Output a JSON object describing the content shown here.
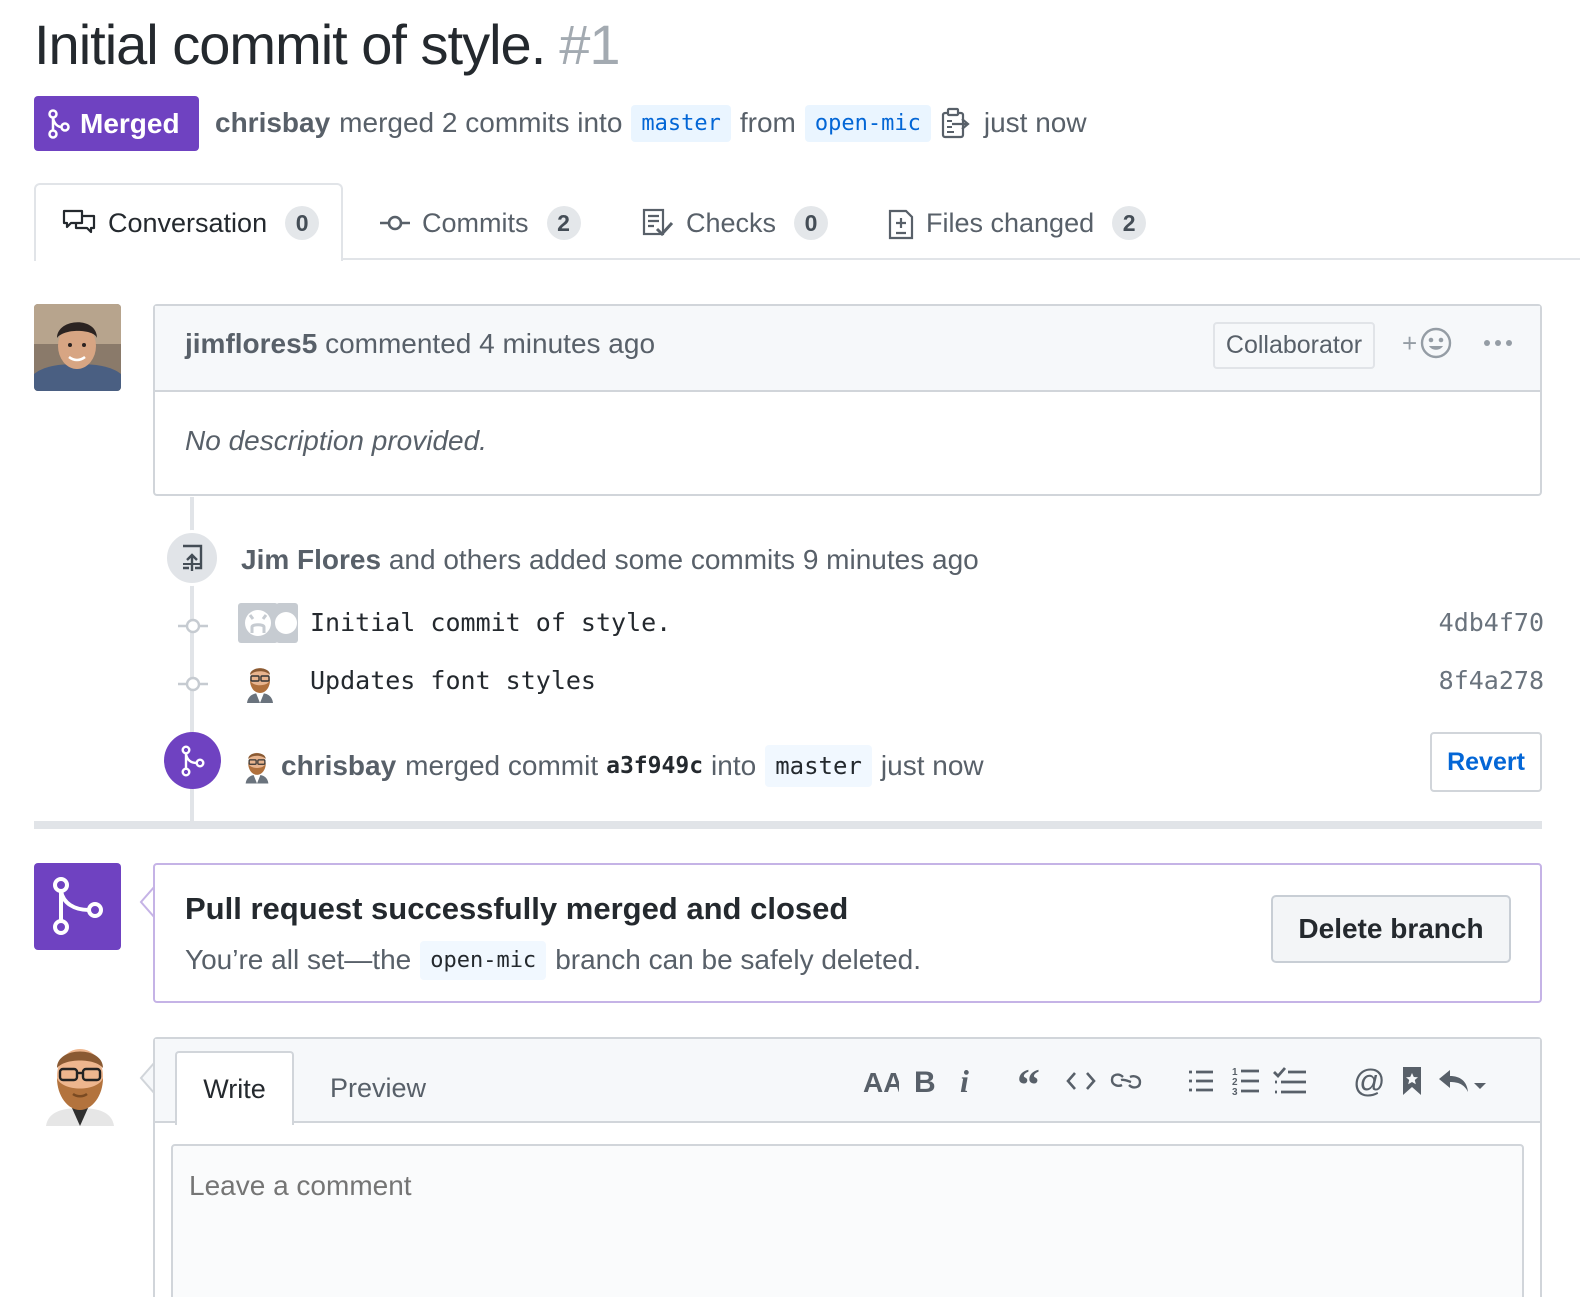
{
  "pr": {
    "title": "Initial commit of style.",
    "number": "#1",
    "state": "Merged",
    "author": "chrisbay",
    "summary": "merged 2 commits into",
    "base_branch": "master",
    "from_word": "from",
    "head_branch": "open-mic",
    "time": "just now"
  },
  "tabs": [
    {
      "label": "Conversation",
      "count": "0",
      "icon": "comment-discussion-icon"
    },
    {
      "label": "Commits",
      "count": "2",
      "icon": "git-commit-icon"
    },
    {
      "label": "Checks",
      "count": "0",
      "icon": "checklist-icon"
    },
    {
      "label": "Files changed",
      "count": "2",
      "icon": "diff-icon"
    }
  ],
  "comment": {
    "author": "jimflores5",
    "action": "commented 4 minutes ago",
    "role": "Collaborator",
    "reaction_plus": "+",
    "body": "No description provided."
  },
  "timeline": {
    "added_author": "Jim Flores",
    "added_text": "and others added some commits 9 minutes ago",
    "commits": [
      {
        "message": "Initial commit of style.",
        "sha": "4db4f70"
      },
      {
        "message": "Updates font styles",
        "sha": "8f4a278"
      }
    ],
    "merge_author": "chrisbay",
    "merge_text": "merged commit",
    "merge_sha": "a3f949c",
    "into_word": "into",
    "merge_branch": "master",
    "merge_time": "just now",
    "revert_label": "Revert"
  },
  "merged_box": {
    "title": "Pull request successfully merged and closed",
    "sub_before": "You’re all set—the",
    "branch": "open-mic",
    "sub_after": "branch can be safely deleted.",
    "delete_label": "Delete branch"
  },
  "editor": {
    "write_tab": "Write",
    "preview_tab": "Preview",
    "placeholder": "Leave a comment",
    "toolbar": [
      "header-icon",
      "bold-icon",
      "italic-icon",
      "quote-icon",
      "code-icon",
      "link-icon",
      "bulleted-list-icon",
      "numbered-list-icon",
      "task-list-icon",
      "mention-icon",
      "saved-reply-icon",
      "reply-icon"
    ]
  },
  "colors": {
    "merged_purple": "#6f42c1",
    "link_blue": "#0366d6",
    "muted_text": "#586069"
  }
}
